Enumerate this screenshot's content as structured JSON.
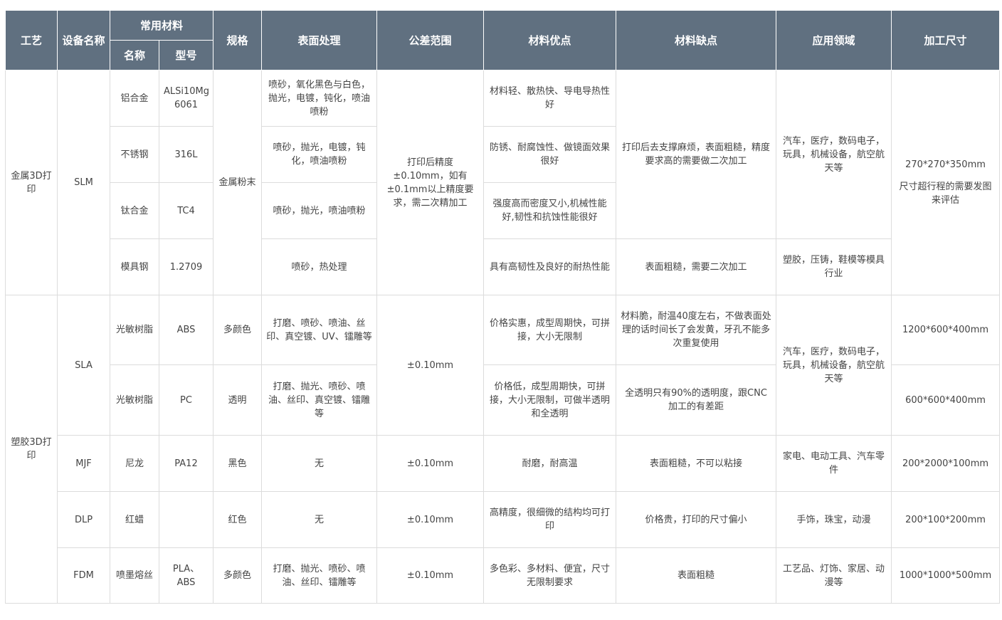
{
  "headers": {
    "process": "工艺",
    "device": "设备名称",
    "material_group": "常用材料",
    "material_name": "名称",
    "material_model": "型号",
    "spec": "规格",
    "surface": "表面处理",
    "tolerance": "公差范围",
    "advantages": "材料优点",
    "disadvantages": "材料缺点",
    "application": "应用领域",
    "size": "加工尺寸"
  },
  "metal": {
    "process": "金属3D打印",
    "device": "SLM",
    "spec": "金属粉末",
    "tolerance": "打印后精度±0.10mm，如有±0.1mm以上精度要求，需二次精加工",
    "disadv_main": "打印后去支撑麻烦，表面粗糙，精度要求高的需要做二次加工",
    "app_main": "汽车，医疗，数码电子，玩具，机械设备，航空航天等",
    "size_line1": "270*270*350mm",
    "size_line2": "尺寸超行程的需要发图来评估",
    "rows": [
      {
        "name": "铝合金",
        "model": "ALSi10Mg 6061",
        "surface": "喷砂，氧化黑色与白色，抛光，电镀，钝化，喷油喷粉",
        "adv": "材料轻、散热快、导电导热性好"
      },
      {
        "name": "不锈钢",
        "model": "316L",
        "surface": "喷砂，抛光，电镀，钝化，喷油喷粉",
        "adv": "防锈、耐腐蚀性、做镜面效果很好"
      },
      {
        "name": "钛合金",
        "model": "TC4",
        "surface": "喷砂，抛光，喷油喷粉",
        "adv": "强度高而密度又小,机械性能好,韧性和抗蚀性能很好"
      },
      {
        "name": "模具钢",
        "model": "1.2709",
        "surface": "喷砂，热处理",
        "adv": "具有高韧性及良好的耐热性能",
        "disadv": "表面粗糙，需要二次加工",
        "app": "塑胶，压铸，鞋模等模具行业"
      }
    ]
  },
  "plastic": {
    "process": "塑胶3D打印",
    "sla": {
      "device": "SLA",
      "tolerance": "±0.10mm",
      "app": "汽车，医疗，数码电子，玩具，机械设备，航空航天等",
      "rows": [
        {
          "name": "光敏树脂",
          "model": "ABS",
          "spec": "多颜色",
          "surface": "打磨、喷砂、喷油、丝印、真空镀、UV、镭雕等",
          "adv": "价格实惠，成型周期快，可拼接，大小无限制",
          "disadv": "材料脆，耐温40度左右，不做表面处理的话时间长了会发黄，牙孔不能多次重复使用",
          "size": "1200*600*400mm"
        },
        {
          "name": "光敏树脂",
          "model": "PC",
          "spec": "透明",
          "surface": "打磨、抛光、喷砂、喷油、丝印、真空镀、镭雕等",
          "adv": "价格低，成型周期快，可拼接，大小无限制，可做半透明和全透明",
          "disadv": "全透明只有90%的透明度，跟CNC加工的有差距",
          "size": "600*600*400mm"
        }
      ]
    },
    "others": [
      {
        "device": "MJF",
        "name": "尼龙",
        "model": "PA12",
        "spec": "黑色",
        "surface": "无",
        "tolerance": "±0.10mm",
        "adv": "耐磨，耐高温",
        "disadv": "表面粗糙，不可以粘接",
        "app": "家电、电动工具、汽车零件",
        "size": "200*2000*100mm"
      },
      {
        "device": "DLP",
        "name": "红蜡",
        "model": "",
        "spec": "红色",
        "surface": "无",
        "tolerance": "±0.10mm",
        "adv": "高精度，很细微的结构均可打印",
        "disadv": "价格贵，打印的尺寸偏小",
        "app": "手饰，珠宝，动漫",
        "size": "200*100*200mm"
      },
      {
        "device": "FDM",
        "name": "喷墨熔丝",
        "model": "PLA、ABS",
        "spec": "多颜色",
        "surface": "打磨、抛光、喷砂、喷油、丝印、镭雕等",
        "tolerance": "±0.10mm",
        "adv": "多色彩、多材料、便宜，尺寸无限制要求",
        "disadv": "表面粗糙",
        "app": "工艺品、灯饰、家居、动漫等",
        "size": "1000*1000*500mm"
      }
    ]
  },
  "colors": {
    "header_bg": "#607080",
    "header_text": "#ffffff",
    "border": "#dcdcdc",
    "body_text": "#444444"
  }
}
